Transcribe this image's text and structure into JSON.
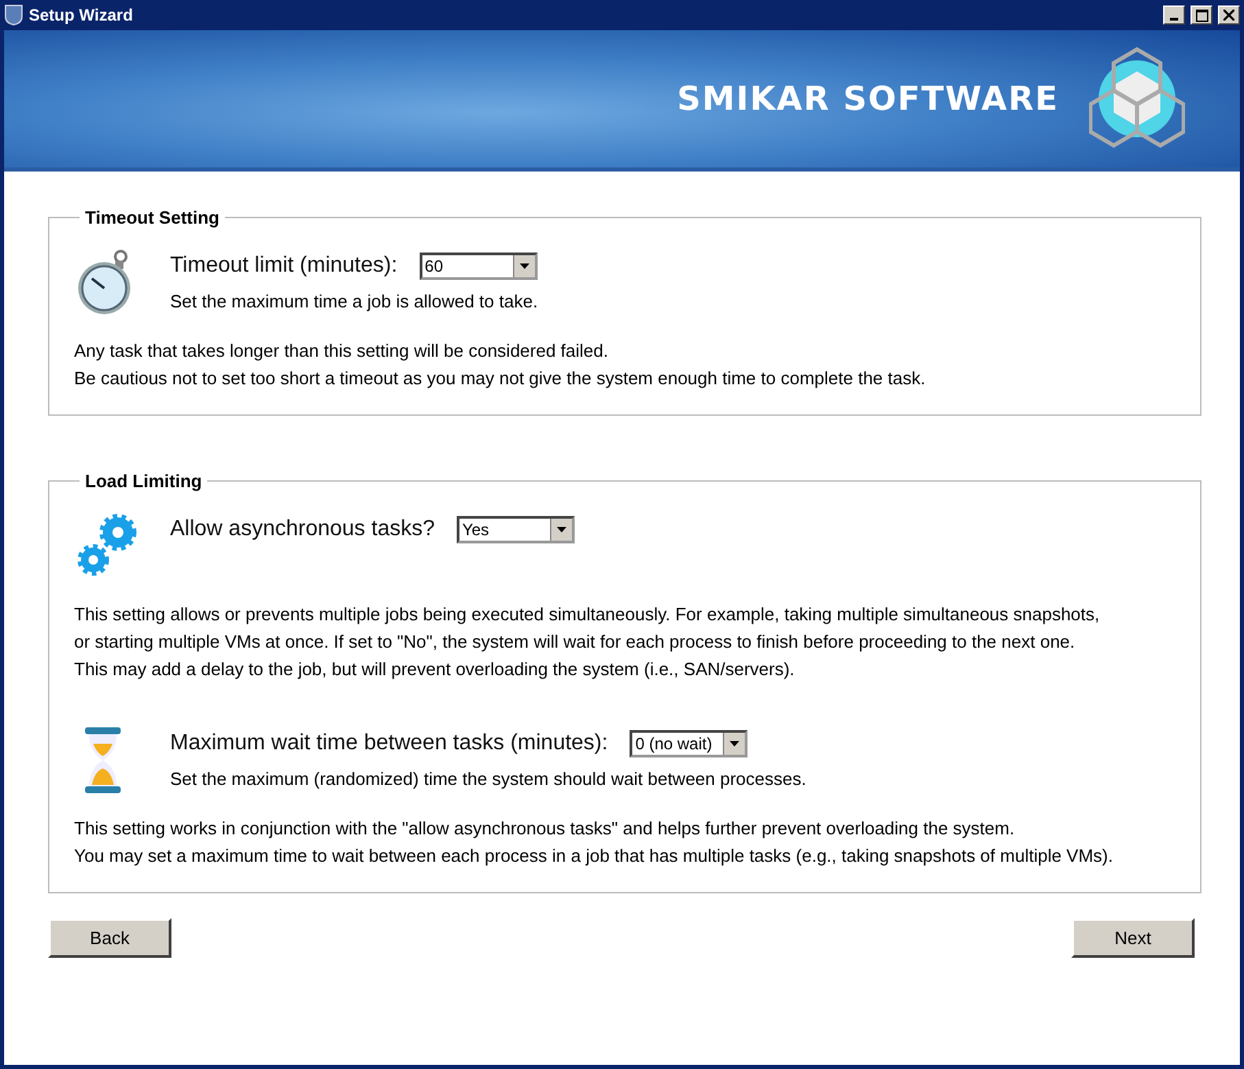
{
  "window": {
    "title": "Setup Wizard"
  },
  "banner": {
    "brand": "SMIKAR SOFTWARE"
  },
  "sections": [
    {
      "title": "Timeout Setting",
      "blocks": [
        {
          "kind": "setting",
          "label": "Timeout limit (minutes):",
          "value": "60",
          "hint": "Set the maximum time a job is allowed to take."
        },
        {
          "kind": "note",
          "lines": [
            "Any task that takes longer than this setting will be considered failed.",
            "Be cautious not to set too short a timeout as you may not give the system enough time to complete the task."
          ]
        }
      ]
    },
    {
      "title": "Load Limiting",
      "blocks": [
        {
          "kind": "setting",
          "label": "Allow asynchronous tasks?",
          "value": "Yes"
        },
        {
          "kind": "note",
          "lines": [
            "This setting allows or prevents multiple jobs being executed simultaneously. For example, taking multiple simultaneous snapshots,",
            "or starting multiple VMs at once. If set to \"No\", the system will wait for each process to finish before proceeding to the next one.",
            "This may add a delay to the job, but will prevent overloading the system (i.e., SAN/servers)."
          ]
        },
        {
          "kind": "setting",
          "label": "Maximum wait time between tasks (minutes):",
          "value": "0 (no wait)",
          "hint": "Set the maximum (randomized) time the system should wait between processes."
        },
        {
          "kind": "note",
          "lines": [
            "This setting works in conjunction with the \"allow asynchronous tasks\" and helps further prevent overloading the system.",
            "You may set a maximum time to wait between each process in a job that has multiple tasks (e.g., taking snapshots of multiple VMs)."
          ]
        }
      ]
    }
  ],
  "buttons": {
    "back": "Back",
    "next": "Next"
  }
}
